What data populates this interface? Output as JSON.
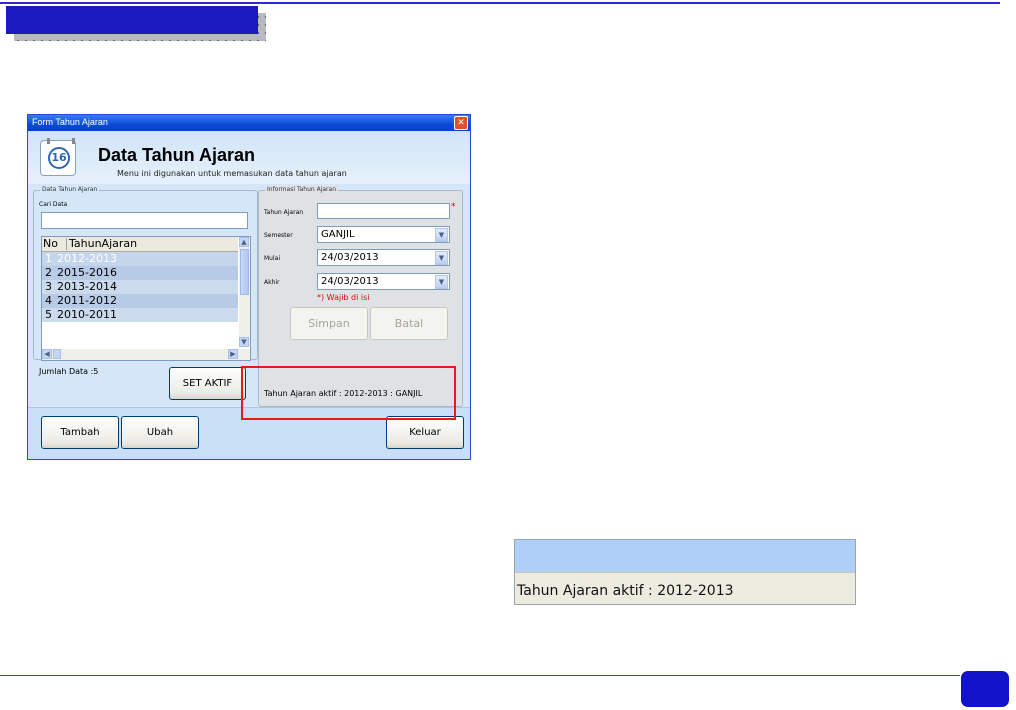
{
  "window": {
    "title": "Form Tahun Ajaran",
    "close_glyph": "✕"
  },
  "header": {
    "icon_number": "16",
    "title": "Data Tahun Ajaran",
    "subtitle": "Menu ini digunakan untuk memasukan data tahun ajaran"
  },
  "left_group": {
    "legend": "Data Tahun Ajaran",
    "search_label": "Cari Data",
    "search_value": "",
    "columns": [
      "No",
      "TahunAjaran"
    ],
    "rows": [
      {
        "no": "1",
        "tahun": "2012-2013"
      },
      {
        "no": "2",
        "tahun": "2015-2016"
      },
      {
        "no": "3",
        "tahun": "2013-2014"
      },
      {
        "no": "4",
        "tahun": "2011-2012"
      },
      {
        "no": "5",
        "tahun": "2010-2011"
      }
    ],
    "count_label": "Jumlah Data :5",
    "set_aktif_label": "SET AKTIF"
  },
  "right_group": {
    "legend": "Informasi Tahun Ajaran",
    "tahun_label": "Tahun Ajaran",
    "tahun_value": "",
    "required_mark": "*",
    "semester_label": "Semester",
    "semester_value": "GANJIL",
    "mulai_label": "Mulai",
    "mulai_value": "24/03/2013",
    "akhir_label": "Akhir",
    "akhir_value": "24/03/2013",
    "required_note": "*) Wajib di isi",
    "simpan_label": "Simpan",
    "batal_label": "Batal",
    "active_info": "Tahun Ajaran aktif : 2012-2013 : GANJIL"
  },
  "footer": {
    "tambah_label": "Tambah",
    "ubah_label": "Ubah",
    "keluar_label": "Keluar"
  },
  "zoom": {
    "text": "Tahun Ajaran aktif :  2012-2013"
  },
  "colors": {
    "slide_accent": "#1a1ac0",
    "highlight": "#e61a1a",
    "required": "#d01010"
  },
  "icons": {
    "calendar": "calendar-icon",
    "dropdown": "chevron-down-icon",
    "close": "close-icon"
  }
}
